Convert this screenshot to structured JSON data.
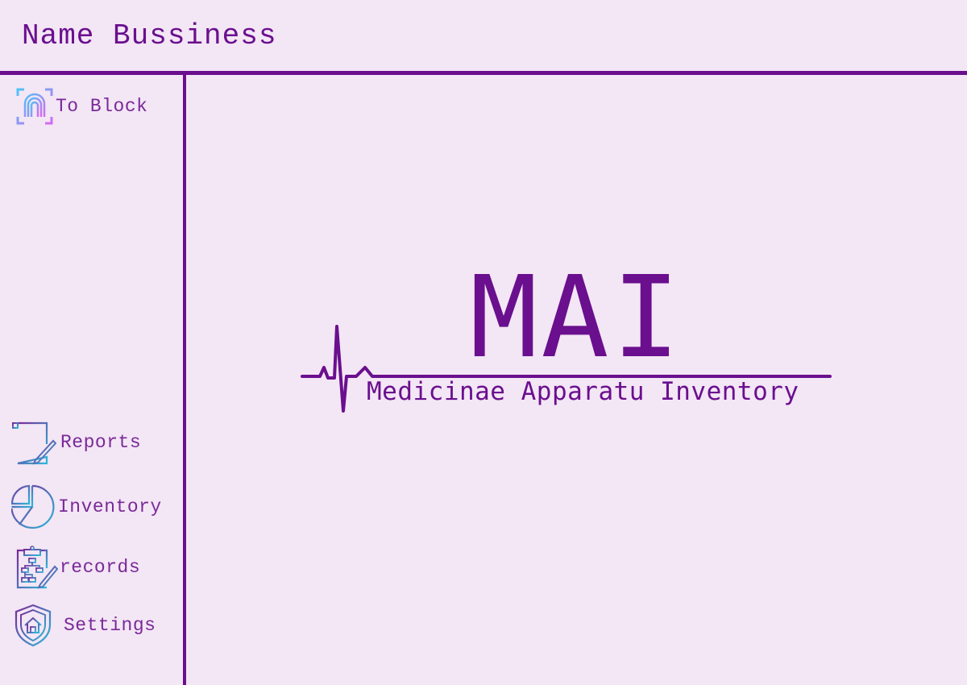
{
  "header": {
    "business_name": "Name Bussiness"
  },
  "sidebar": {
    "top_item": {
      "label": "To Block",
      "icon": "fingerprint-icon"
    },
    "items": [
      {
        "label": "Reports",
        "icon": "report-edit-icon"
      },
      {
        "label": "Inventory",
        "icon": "pie-chart-icon"
      },
      {
        "label": "records",
        "icon": "clipboard-hierarchy-icon"
      },
      {
        "label": "Settings",
        "icon": "shield-home-icon"
      }
    ]
  },
  "logo": {
    "title": "MAI",
    "subtitle": "Medicinae Apparatu Inventory"
  },
  "colors": {
    "background": "#f3e6f5",
    "accent": "#6a0f8e",
    "icon_gradient_start": "#2bb8d8",
    "icon_gradient_end": "#7a2a98"
  }
}
